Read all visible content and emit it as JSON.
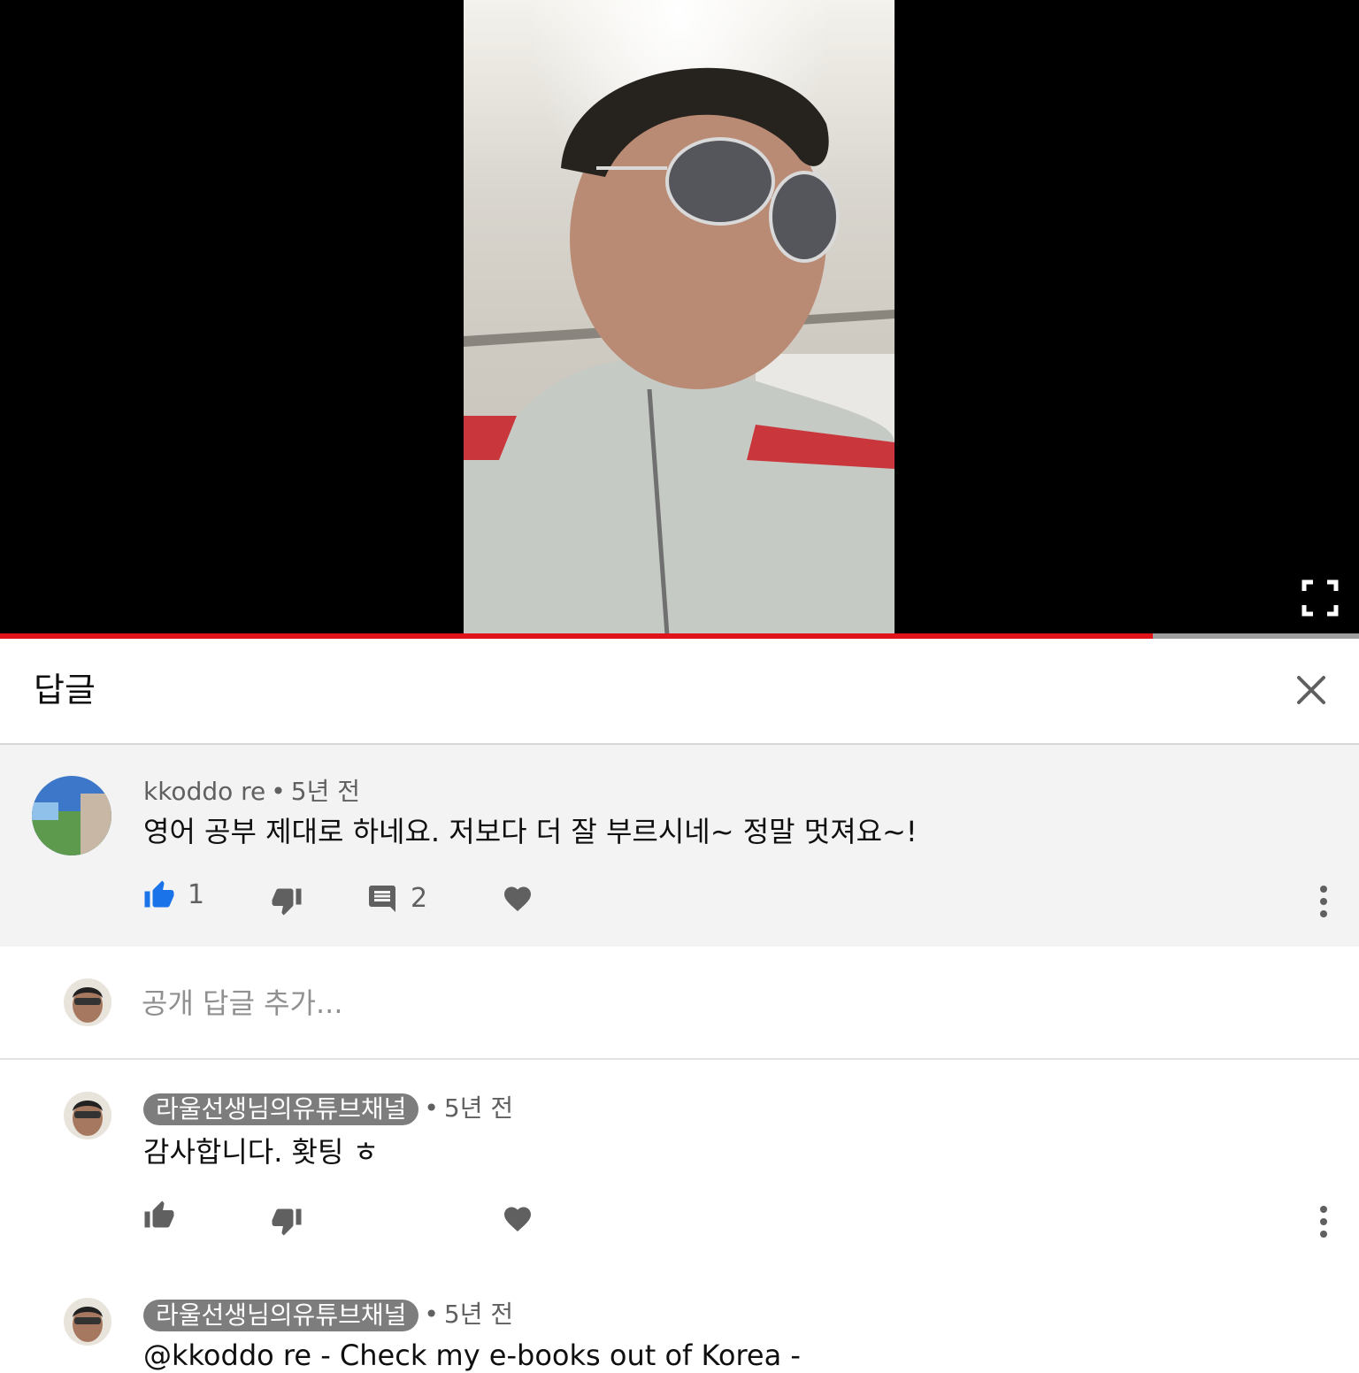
{
  "header": {
    "title": "답글",
    "close_icon": "close-icon"
  },
  "player": {
    "progress_fraction": 0.848,
    "fullscreen_icon": "fullscreen-icon"
  },
  "colors": {
    "progress": "#e0131a",
    "like_active": "#1a73e8",
    "owner_badge": "#7d7d7d"
  },
  "parent_comment": {
    "author": "kkoddo re",
    "separator": "•",
    "time": "5년 전",
    "text": "영어 공부 제대로 하네요. 저보다 더 잘 부르시네~ 정말 멋져요~!",
    "like_count": "1",
    "reply_count": "2"
  },
  "reply_box": {
    "placeholder": "공개 답글 추가..."
  },
  "replies": [
    {
      "author": "라울선생님의유튜브채널",
      "separator": "•",
      "time": "5년 전",
      "text": "감사합니다. 홧팅 ㅎ"
    },
    {
      "author": "라울선생님의유튜브채널",
      "separator": "•",
      "time": "5년 전",
      "text": "@kkoddo re - Check my e-books out of Korea -"
    }
  ]
}
